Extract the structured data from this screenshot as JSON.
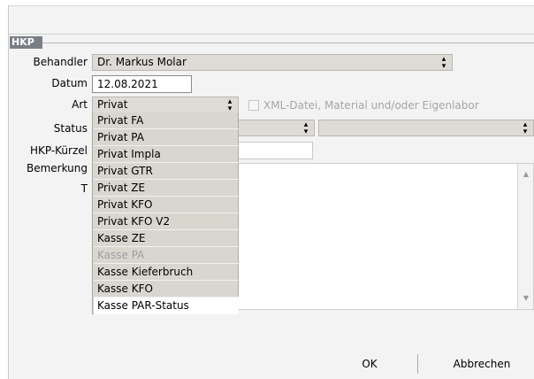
{
  "section_tag": "HKP",
  "labels": {
    "behandler": "Behandler",
    "datum": "Datum",
    "art": "Art",
    "status": "Status",
    "kuerzel": "HKP-Kürzel",
    "bemerkung": "Bemerkung",
    "t": "T"
  },
  "behandler_value": "Dr. Markus Molar",
  "datum_value": "12.08.2021",
  "art_value": "Privat",
  "xml_checkbox_label": "XML-Datei, Material und/oder Eigenlabor",
  "art_options": [
    {
      "label": "Privat FA",
      "disabled": false
    },
    {
      "label": "Privat PA",
      "disabled": false
    },
    {
      "label": "Privat Impla",
      "disabled": false
    },
    {
      "label": "Privat GTR",
      "disabled": false
    },
    {
      "label": "Privat ZE",
      "disabled": false
    },
    {
      "label": "Privat KFO",
      "disabled": false
    },
    {
      "label": "Privat KFO V2",
      "disabled": false
    },
    {
      "label": "Kasse ZE",
      "disabled": false
    },
    {
      "label": "Kasse PA",
      "disabled": true
    },
    {
      "label": "Kasse Kieferbruch",
      "disabled": false
    },
    {
      "label": "Kasse KFO",
      "disabled": false
    },
    {
      "label": "Kasse PAR-Status",
      "disabled": false,
      "highlighted": true
    }
  ],
  "buttons": {
    "ok": "OK",
    "cancel": "Abbrechen"
  },
  "icons": {
    "combo_arrows": "up-down-arrows-icon",
    "scroll_up": "scroll-up-arrow-icon",
    "scroll_down": "scroll-down-arrow-icon"
  },
  "colors": {
    "combo_bg": "#dedbd6",
    "section_tag_bg": "#7a7f86",
    "dialog_bg": "#f3f3f3"
  }
}
